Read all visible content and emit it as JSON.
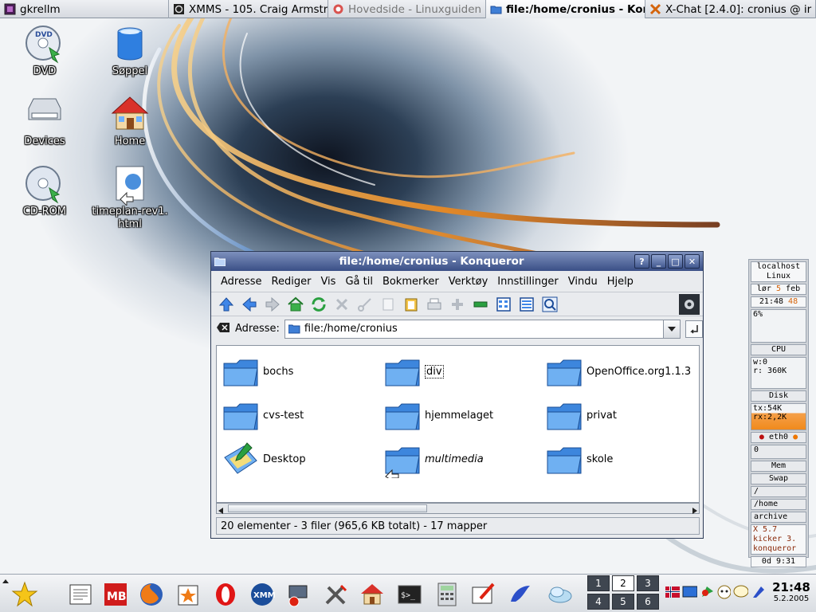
{
  "taskbar": {
    "tasks": [
      {
        "label": "gkrellm",
        "icon": "gkrellm-icon"
      },
      {
        "label": "XMMS - 105. Craig Armstror",
        "icon": "xmms-icon"
      },
      {
        "label": "Hovedside - Linuxguiden -",
        "icon": "browser-icon"
      },
      {
        "label": "file:/home/cronius - Kor",
        "icon": "folder-icon",
        "active": true
      },
      {
        "label": "X-Chat [2.4.0]: cronius @ ir",
        "icon": "xchat-icon"
      }
    ]
  },
  "desktop": {
    "icons": [
      {
        "label": "DVD",
        "icon": "dvd-icon"
      },
      {
        "label": "Søppel",
        "icon": "trash-icon"
      },
      {
        "label": "Devices",
        "icon": "devices-icon"
      },
      {
        "label": "Home",
        "icon": "home-icon"
      },
      {
        "label": "CD-ROM",
        "icon": "cdrom-icon"
      },
      {
        "label": "timeplan-rev1.\nhtml",
        "label_line1": "timeplan-rev1.",
        "label_line2": "html",
        "icon": "html-file-icon"
      }
    ]
  },
  "window": {
    "title": "file:/home/cronius - Konqueror",
    "buttons": {
      "help": "?",
      "minimize": "_",
      "maximize": "□",
      "close": "✕"
    },
    "menu": [
      "Adresse",
      "Rediger",
      "Vis",
      "Gå til",
      "Bokmerker",
      "Verktøy",
      "Innstillinger",
      "Vindu",
      "Hjelp"
    ],
    "address_label": "Adresse:",
    "address_value": "file:/home/cronius",
    "files": [
      {
        "name": "bochs",
        "type": "folder"
      },
      {
        "name": "div",
        "type": "folder",
        "selected": true
      },
      {
        "name": "OpenOffice.org1.1.3",
        "type": "folder"
      },
      {
        "name": "cvs-test",
        "type": "folder"
      },
      {
        "name": "hjemmelaget",
        "type": "folder"
      },
      {
        "name": "privat",
        "type": "folder"
      },
      {
        "name": "Desktop",
        "type": "desktop"
      },
      {
        "name": "multimedia",
        "type": "link-folder",
        "italic": true
      },
      {
        "name": "skole",
        "type": "folder"
      }
    ],
    "status": "20 elementer - 3 filer (965,6 KB totalt) - 17 mapper"
  },
  "gkrellm": {
    "host": "localhost",
    "os": "Linux",
    "date_day": "lør",
    "date_num": "5",
    "date_month": "feb",
    "time": "21:48",
    "seconds": "48",
    "cpu_pct": "6%",
    "cpu_label": "CPU",
    "w_val": "w:0",
    "r_val": "r: 360K",
    "disk_label": "Disk",
    "tx": "tx:54K",
    "rx": "rx:2,2K",
    "eth_label": "eth0",
    "eth_val": "0",
    "mem_label": "Mem",
    "swap_label": "Swap",
    "fs1": "/",
    "fs2": "/home",
    "fs3": "archive",
    "proc1": "X   5.7",
    "proc2": "kicker  3.",
    "proc3": "konqueror",
    "uptime": "0d  9:31"
  },
  "panel": {
    "pager": [
      "1",
      "2",
      "3",
      "4",
      "5",
      "6"
    ],
    "pager_current": "2",
    "clock_time": "21:48",
    "clock_date": "5.2.2005"
  },
  "colors": {
    "titlebar": "#3a4f86",
    "accent": "#f08a1c"
  }
}
